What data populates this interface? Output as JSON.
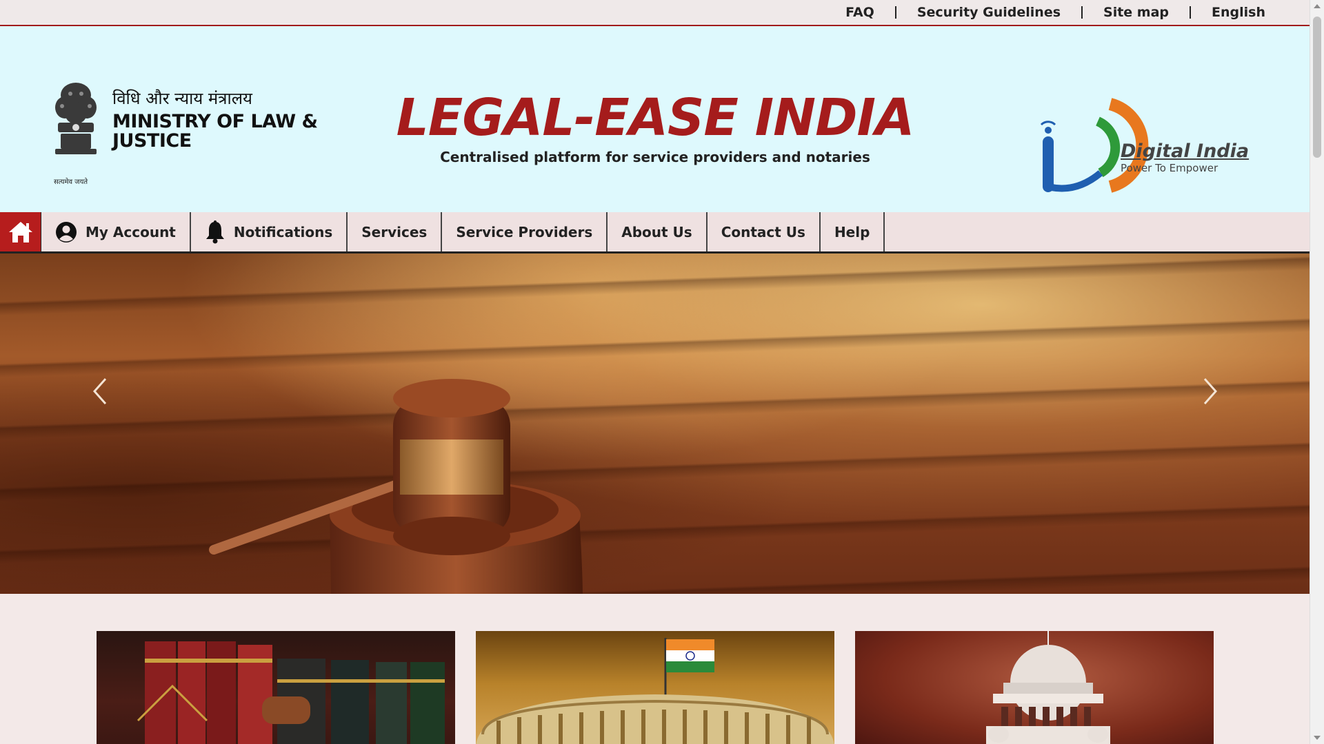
{
  "topbar": {
    "links": [
      "FAQ",
      "Security Guidelines",
      "Site map",
      "English"
    ]
  },
  "header": {
    "ministry_hindi": "विधि और न्याय मंत्रालय",
    "ministry_english": "MINISTRY OF LAW & JUSTICE",
    "emblem_caption": "सत्यमेव जयते",
    "site_title": "LEGAL-EASE INDIA",
    "site_subtitle": "Centralised platform for service providers and notaries",
    "digital_india_title": "Digital India",
    "digital_india_tagline": "Power To Empower"
  },
  "nav": {
    "home_icon": "home-icon",
    "items": [
      {
        "label": "My Account",
        "icon": "user-circle-icon"
      },
      {
        "label": "Notifications",
        "icon": "bell-icon"
      },
      {
        "label": "Services"
      },
      {
        "label": "Service Providers"
      },
      {
        "label": "About Us"
      },
      {
        "label": "Contact Us"
      },
      {
        "label": "Help"
      }
    ]
  },
  "hero": {
    "image": "courtroom-gavel",
    "prev_icon": "chevron-left-icon",
    "next_icon": "chevron-right-icon"
  },
  "cards": [
    {
      "image": "law-books-scale"
    },
    {
      "image": "parliament-flag"
    },
    {
      "image": "supreme-court-dome"
    }
  ],
  "colors": {
    "brand_red": "#a51c1c",
    "header_bg": "#def9fd",
    "nav_bg": "#efe1e1",
    "home_bg": "#b61d1d"
  }
}
